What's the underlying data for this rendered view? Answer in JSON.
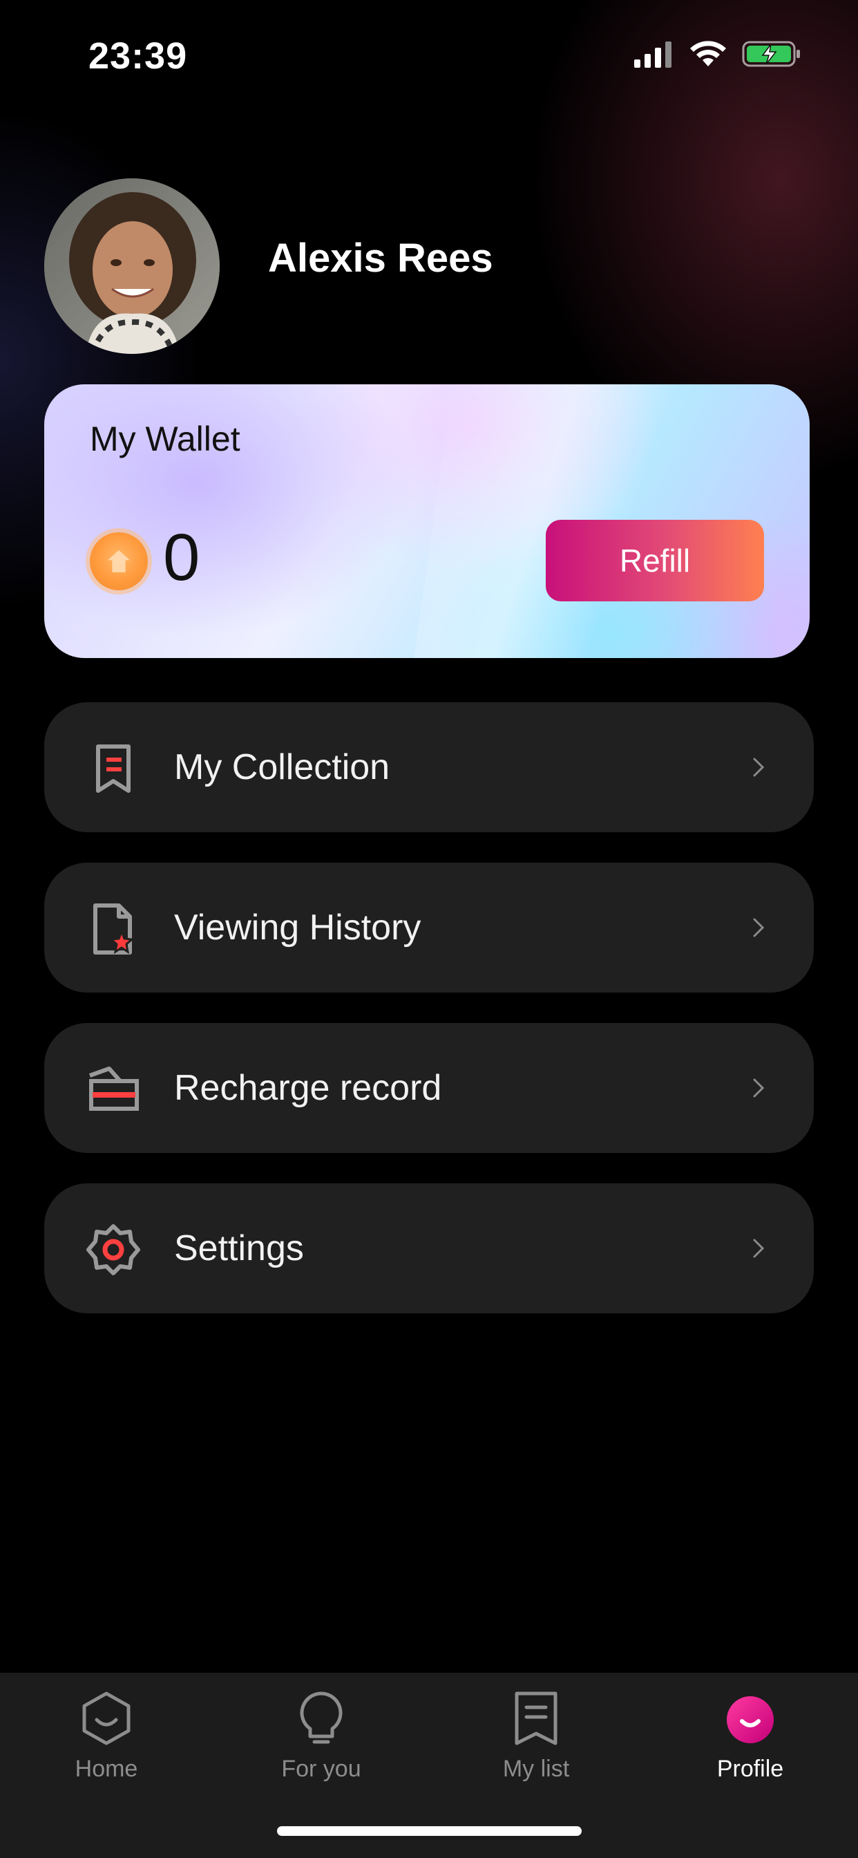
{
  "status_bar": {
    "time": "23:39"
  },
  "profile": {
    "name": "Alexis Rees"
  },
  "wallet": {
    "title": "My Wallet",
    "balance": "0",
    "refill_label": "Refill"
  },
  "menu": [
    {
      "label": "My Collection",
      "icon": "bookmark-icon"
    },
    {
      "label": "Viewing History",
      "icon": "history-document-icon"
    },
    {
      "label": "Recharge record",
      "icon": "recharge-card-icon"
    },
    {
      "label": "Settings",
      "icon": "gear-icon"
    }
  ],
  "tabs": [
    {
      "label": "Home",
      "icon": "home-icon"
    },
    {
      "label": "For you",
      "icon": "lightbulb-icon"
    },
    {
      "label": "My list",
      "icon": "list-bookmark-icon"
    },
    {
      "label": "Profile",
      "icon": "profile-smile-icon",
      "active": true
    }
  ],
  "colors": {
    "accent": "#e0117f",
    "card_bg": "#202020",
    "tab_bg": "#1c1c1c",
    "refill_from": "#c8107a",
    "refill_to": "#ff8050"
  }
}
